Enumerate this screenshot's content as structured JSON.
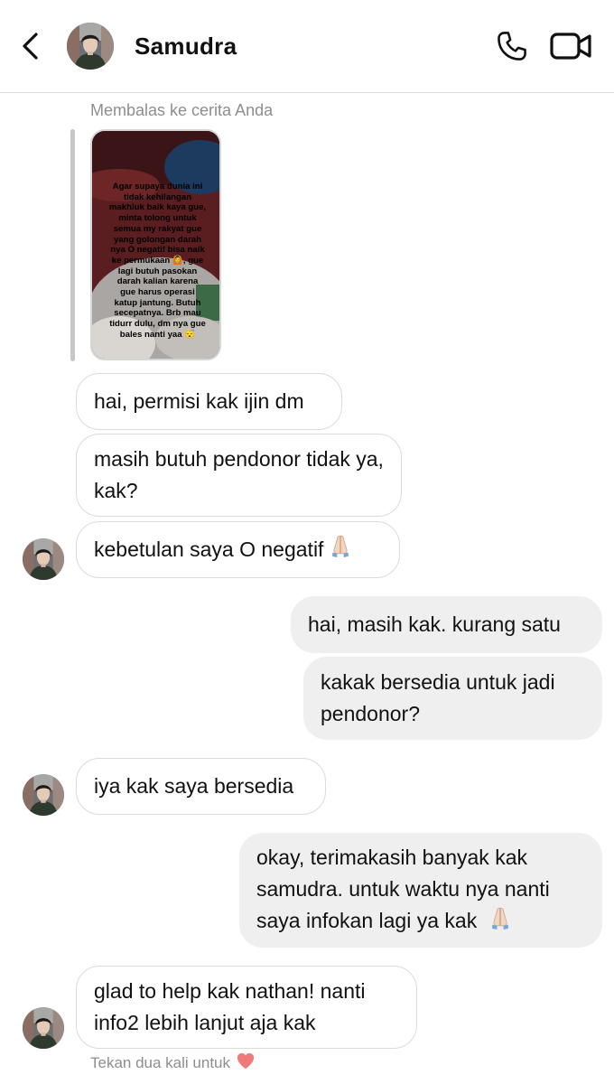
{
  "header": {
    "contact_name": "Samudra",
    "icons": [
      "back-chevron-icon",
      "avatar",
      "phone-icon",
      "video-camera-icon"
    ]
  },
  "story_reply": {
    "label": "Membalas ke cerita Anda",
    "story_text": "Agar supaya dunia ini tidak kehilangan makhluk baik kaya gue, minta tolong untuk semua my rakyat gue yang golongan darah nya O negatif bisa naik ke permukaan 🙆, gue lagi butuh pasokan darah kalian karena gue harus operasi katup jantung. Butuh secepatnya. Brb mau tidurr dulu, dm nya gue bales nanti yaa 😴"
  },
  "messages": [
    {
      "sender": "them",
      "text": "hai, permisi kak ijin dm"
    },
    {
      "sender": "them",
      "text": "masih butuh pendonor tidak ya, kak?"
    },
    {
      "sender": "them",
      "text": "kebetulan saya O negatif",
      "emoji": "praying-hands"
    },
    {
      "sender": "me",
      "text": "hai, masih kak. kurang satu"
    },
    {
      "sender": "me",
      "text": "kakak bersedia untuk jadi pendonor?"
    },
    {
      "sender": "them",
      "text": "iya kak saya bersedia"
    },
    {
      "sender": "me",
      "text": "okay, terimakasih banyak kak samudra. untuk waktu nya nanti saya infokan lagi ya kak",
      "emoji": "praying-hands"
    },
    {
      "sender": "them",
      "text": "glad to help kak nathan! nanti info2 lebih lanjut aja kak"
    }
  ],
  "footer_hint": {
    "text": "Tekan dua kali untuk",
    "icon": "heart-icon"
  },
  "colors": {
    "incoming_border": "#dbdbdb",
    "outgoing_bg": "#efefef",
    "muted_text": "#8e8e8e",
    "heart": "#ed4956"
  }
}
